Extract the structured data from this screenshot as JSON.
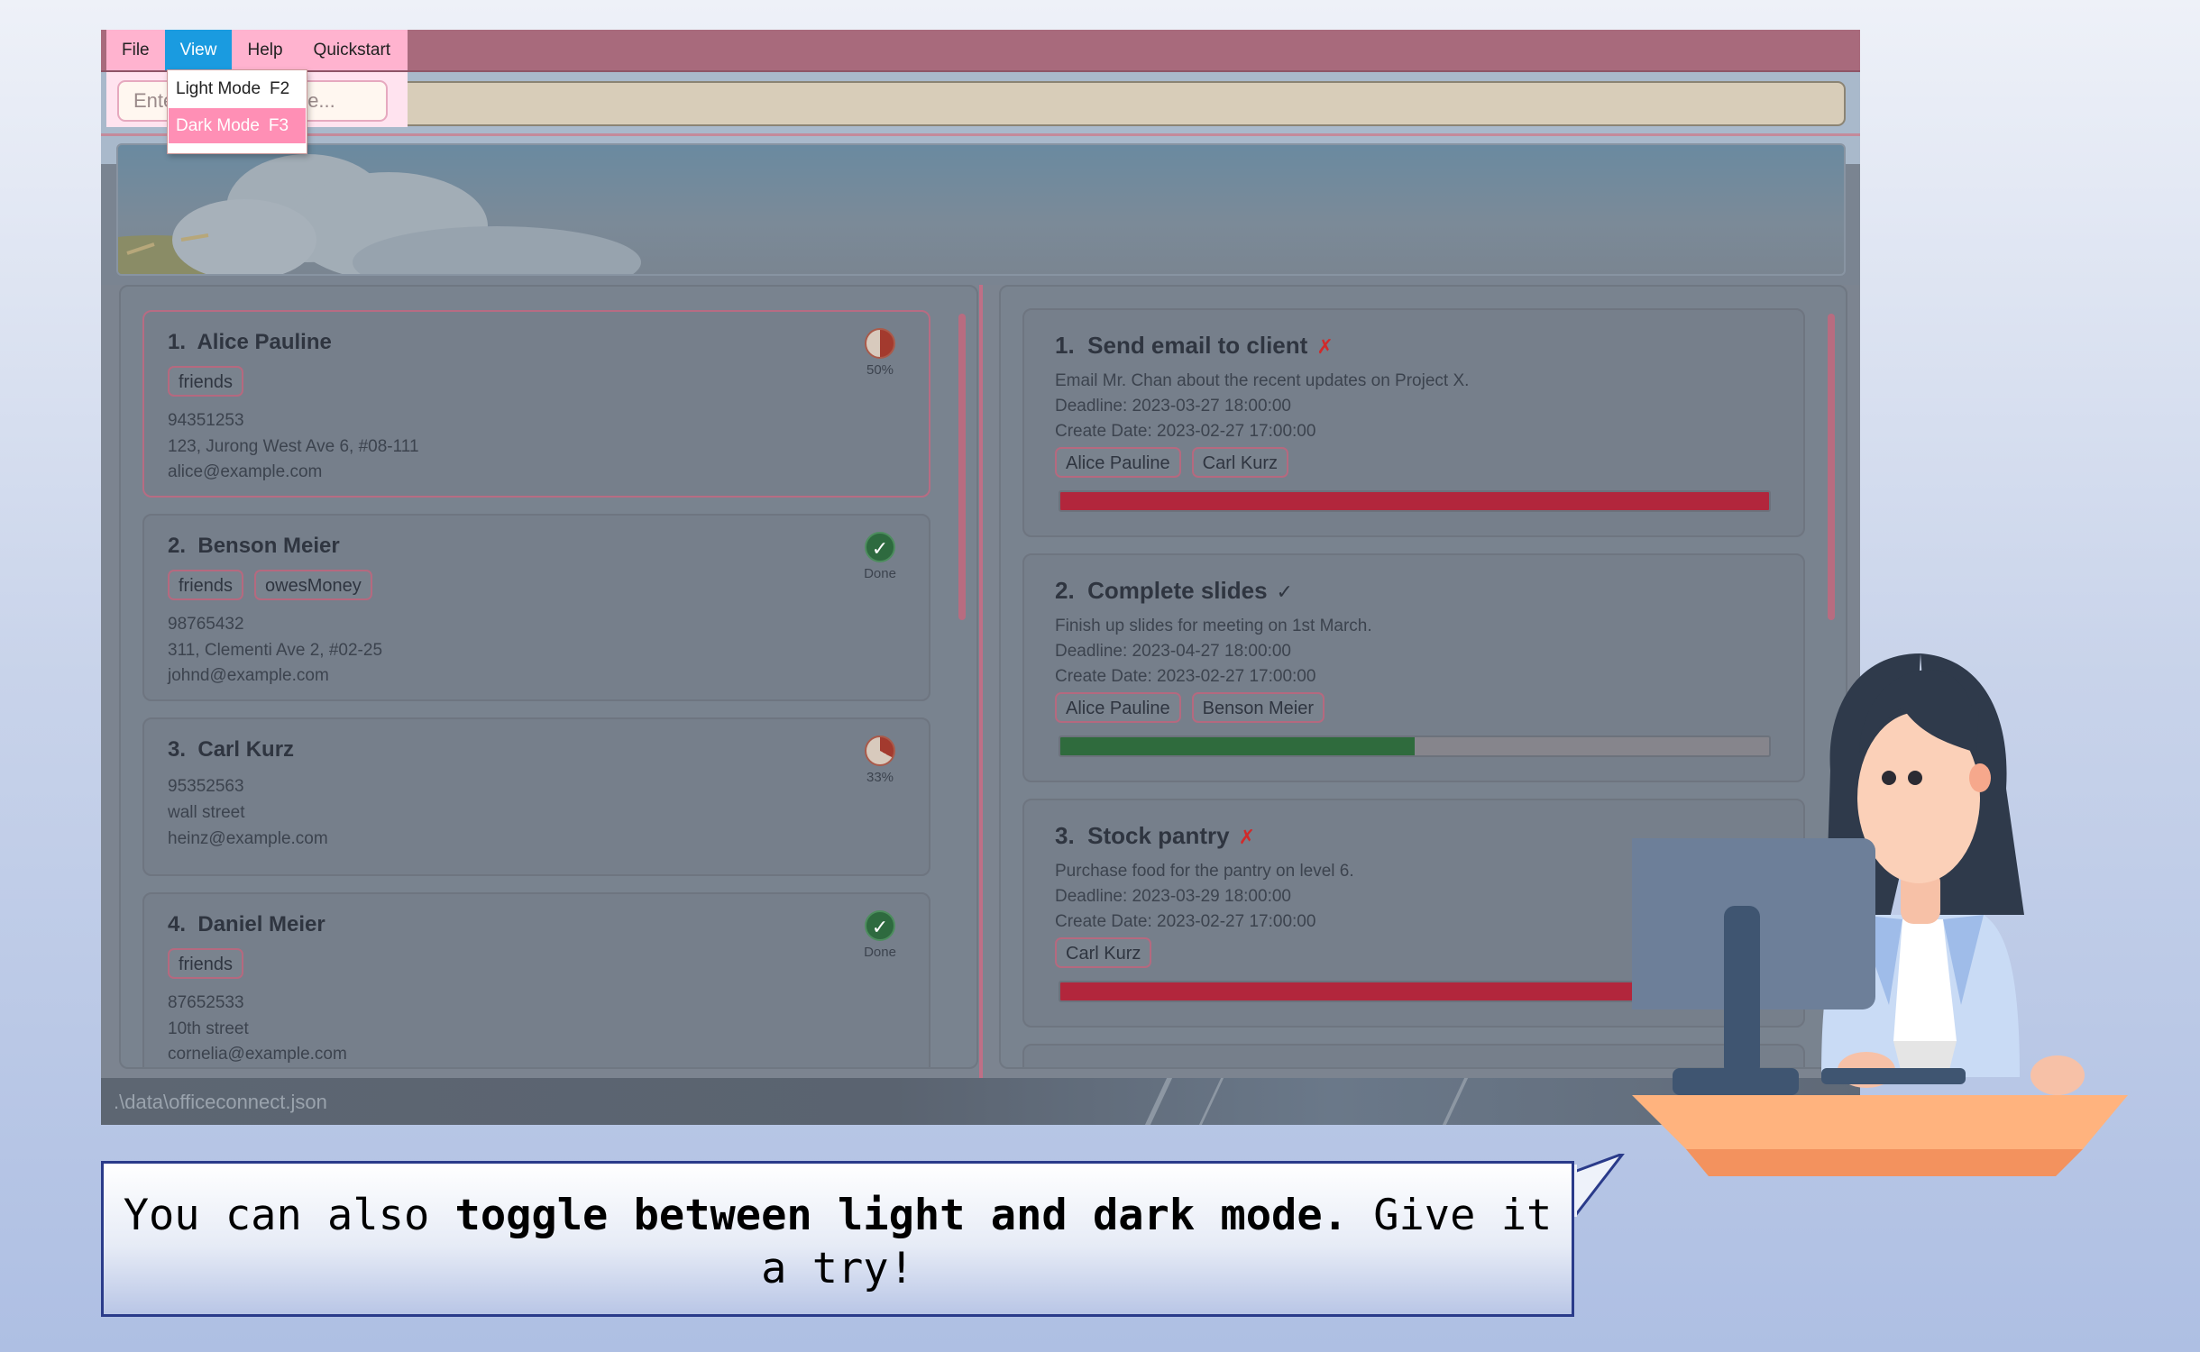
{
  "menubar": {
    "items": [
      {
        "label": "File",
        "name": "menu-file"
      },
      {
        "label": "View",
        "name": "menu-view"
      },
      {
        "label": "Help",
        "name": "menu-help"
      },
      {
        "label": "Quickstart",
        "name": "menu-quickstart"
      }
    ],
    "active": "View"
  },
  "view_menu": {
    "items": [
      {
        "label": "Light Mode",
        "accel": "F2"
      },
      {
        "label": "Dark Mode",
        "accel": "F3"
      }
    ],
    "selected": "Dark Mode"
  },
  "command": {
    "placeholder": "Enter command here..."
  },
  "persons": [
    {
      "index": "1.",
      "name": "Alice Pauline",
      "tags": [
        "friends"
      ],
      "phone": "94351253",
      "address": "123, Jurong West Ave 6, #08-111",
      "email": "alice@example.com",
      "status": "50%",
      "status_type": "pie",
      "progress": 0.5
    },
    {
      "index": "2.",
      "name": "Benson Meier",
      "tags": [
        "friends",
        "owesMoney"
      ],
      "phone": "98765432",
      "address": "311, Clementi Ave 2, #02-25",
      "email": "johnd@example.com",
      "status": "Done",
      "status_type": "done"
    },
    {
      "index": "3.",
      "name": "Carl Kurz",
      "tags": [],
      "phone": "95352563",
      "address": "wall street",
      "email": "heinz@example.com",
      "status": "33%",
      "status_type": "pie",
      "progress": 0.33
    },
    {
      "index": "4.",
      "name": "Daniel Meier",
      "tags": [
        "friends"
      ],
      "phone": "87652533",
      "address": "10th street",
      "email": "cornelia@example.com",
      "status": "Done",
      "status_type": "done"
    }
  ],
  "tasks": [
    {
      "index": "1.",
      "title": "Send email to client",
      "mark": "✗",
      "done": false,
      "description": "Email Mr. Chan about the recent updates on Project X.",
      "deadline": "Deadline: 2023-03-27 18:00:00",
      "created": "Create Date: 2023-02-27 17:00:00",
      "assignees": [
        "Alice Pauline",
        "Carl Kurz"
      ],
      "progress": 1.0,
      "bar_color": "#b2263c"
    },
    {
      "index": "2.",
      "title": "Complete slides",
      "mark": "✓",
      "done": true,
      "description": "Finish up slides for meeting on 1st March.",
      "deadline": "Deadline: 2023-04-27 18:00:00",
      "created": "Create Date: 2023-02-27 17:00:00",
      "assignees": [
        "Alice Pauline",
        "Benson Meier"
      ],
      "progress": 0.5,
      "bar_color": "#2f6b3d"
    },
    {
      "index": "3.",
      "title": "Stock pantry",
      "mark": "✗",
      "done": false,
      "description": "Purchase food for the pantry on level 6.",
      "deadline": "Deadline: 2023-03-29 18:00:00",
      "created": "Create Date: 2023-02-27 17:00:00",
      "assignees": [
        "Carl Kurz"
      ],
      "progress": 1.0,
      "bar_color": "#b2263c"
    }
  ],
  "statusbar": {
    "path": ".\\data\\officeconnect.json"
  },
  "bubble": {
    "pre": "You can also ",
    "bold": "toggle between light and dark mode.",
    "post": " Give it a try!"
  },
  "colors": {
    "menu_highlight": "#1a9be0",
    "menubar_pink": "#ffb3cf",
    "selected_item": "#ff8fb5",
    "accent_border": "#b5697f"
  }
}
